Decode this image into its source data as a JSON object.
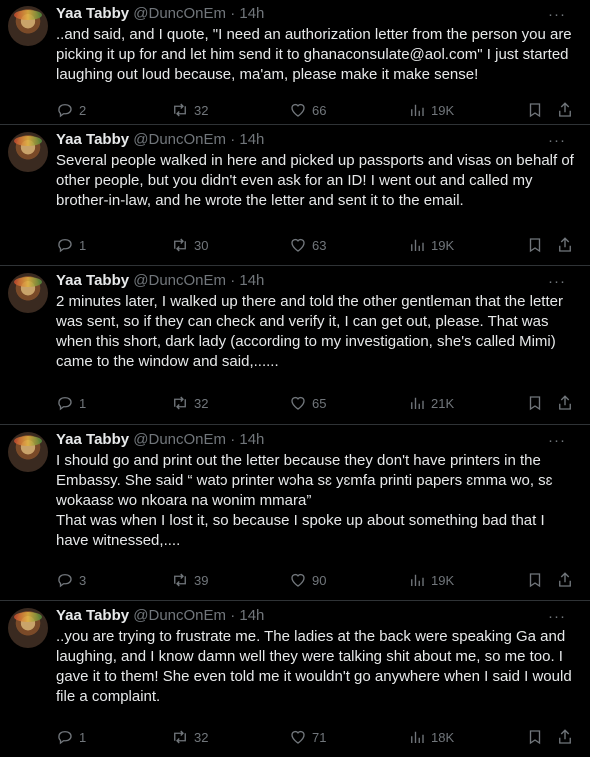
{
  "tweets": [
    {
      "name": "Yaa Tabby",
      "handle": "@DuncOnEm",
      "time": "· 14h",
      "text": "..and said, and I quote, \"I need an authorization letter from the person you are picking it up for and let him send it to ghanaconsulate@aol.com\" I just started laughing out loud because, ma'am, please make it make sense!",
      "replies": "2",
      "retweets": "32",
      "likes": "66",
      "views": "19K"
    },
    {
      "name": "Yaa Tabby",
      "handle": "@DuncOnEm",
      "time": "· 14h",
      "text": "Several people walked in here and picked up passports and visas on behalf of other people, but you didn't even ask for an ID! I went out and called my brother-in-law, and he wrote the letter and sent it to the email.",
      "replies": "1",
      "retweets": "30",
      "likes": "63",
      "views": "19K"
    },
    {
      "name": "Yaa Tabby",
      "handle": "@DuncOnEm",
      "time": "· 14h",
      "text": "2 minutes later, I walked up there and told the other gentleman that the letter was sent, so if they can check and verify it, I can get out, please. That was when this short, dark lady (according to my investigation, she's called Mimi) came to the window and said,......",
      "replies": "1",
      "retweets": "32",
      "likes": "65",
      "views": "21K"
    },
    {
      "name": "Yaa Tabby",
      "handle": "@DuncOnEm",
      "time": "· 14h",
      "text": "I should go and print out the letter because they don't have printers in the Embassy. She said “ watɔ printer wɔha sɛ yɛmfa printi papers ɛmma wo, sɛ wokaasɛ wo nkoara na wonim mmara”\nThat was when I lost it, so because I spoke up about something bad that I have witnessed,....",
      "replies": "3",
      "retweets": "39",
      "likes": "90",
      "views": "19K"
    },
    {
      "name": "Yaa Tabby",
      "handle": "@DuncOnEm",
      "time": "· 14h",
      "text": "..you are trying to frustrate me. The ladies at the back were speaking Ga and laughing, and I know damn well they were talking shit about me, so me too. I gave it to them! She even told me it wouldn't go anywhere when I said I would file a complaint.",
      "replies": "1",
      "retweets": "32",
      "likes": "71",
      "views": "18K"
    }
  ],
  "icons": {
    "more": "more-dots-icon",
    "reply": "reply-icon",
    "retweet": "retweet-icon",
    "like": "heart-icon",
    "views": "views-icon",
    "bookmark": "bookmark-icon",
    "share": "share-icon"
  },
  "colors": {
    "background": "#000000",
    "text": "#e7e9ea",
    "muted": "#71767b",
    "border": "#2f3336"
  }
}
